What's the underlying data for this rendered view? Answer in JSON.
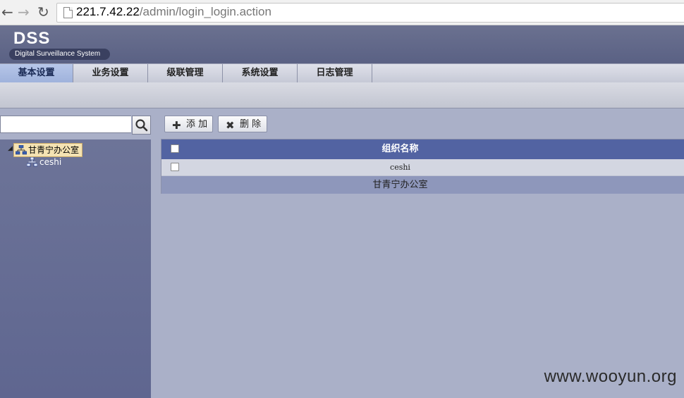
{
  "browser": {
    "back_icon": "arrow-left",
    "forward_icon": "arrow-right",
    "reload_icon": "reload",
    "url_host": "221.7.42.22",
    "url_path": "/admin/login_login.action"
  },
  "header": {
    "title": "DSS",
    "subtitle": "Digital Surveillance System"
  },
  "menu": {
    "items": [
      {
        "label": "基本设置",
        "active": true
      },
      {
        "label": "业务设置"
      },
      {
        "label": "级联管理"
      },
      {
        "label": "系统设置"
      },
      {
        "label": "日志管理"
      }
    ]
  },
  "search": {
    "value": "",
    "icon": "search-icon"
  },
  "tree": {
    "root": "甘青宁办公室",
    "children": [
      "ceshi"
    ]
  },
  "toolbar": {
    "add_label": "添 加",
    "delete_label": "删 除"
  },
  "grid": {
    "header": "组织名称",
    "rows": [
      "ceshi"
    ],
    "footer": "甘青宁办公室"
  },
  "watermark": "www.wooyun.org",
  "colors": {
    "header_bg": "#5a6184",
    "grid_header": "#5263a2",
    "tree_selected": "#f5e3b3"
  }
}
